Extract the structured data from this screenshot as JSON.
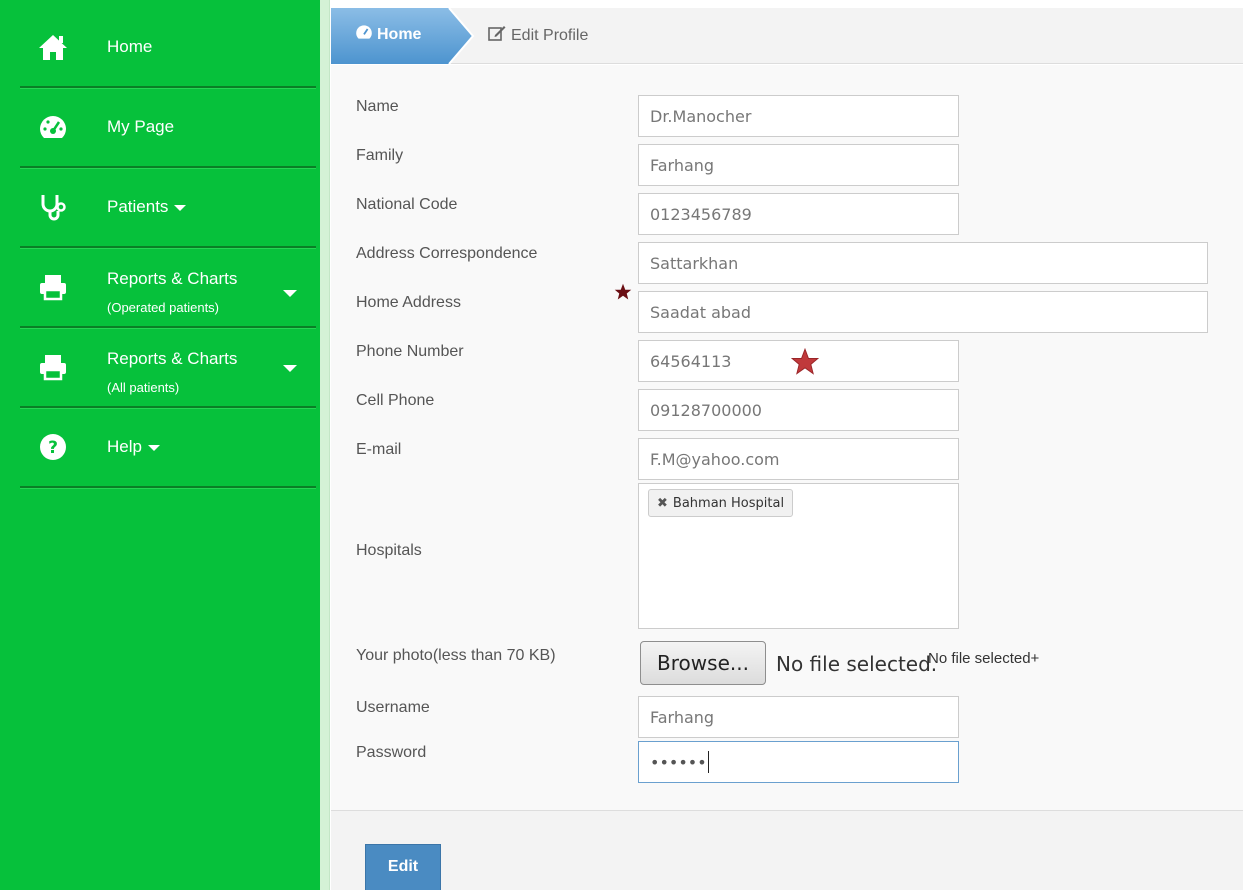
{
  "sidebar": {
    "items": [
      {
        "label": "Home",
        "icon": "home-icon"
      },
      {
        "label": "My Page",
        "icon": "dashboard-icon"
      },
      {
        "label": "Patients",
        "icon": "stethoscope-icon"
      },
      {
        "label": "Reports & Charts",
        "sublabel": "(Operated patients)",
        "icon": "printer-icon"
      },
      {
        "label": "Reports & Charts",
        "sublabel": "(All patients)",
        "icon": "printer-icon"
      },
      {
        "label": "Help",
        "icon": "question-icon"
      }
    ]
  },
  "breadcrumb": {
    "home": "Home",
    "current": "Edit Profile"
  },
  "form": {
    "name": {
      "label": "Name",
      "value": "Dr.Manocher"
    },
    "family": {
      "label": "Family",
      "value": "Farhang"
    },
    "national_code": {
      "label": "National Code",
      "value": "0123456789"
    },
    "address_correspondence": {
      "label": "Address Correspondence",
      "value": "Sattarkhan"
    },
    "home_address": {
      "label": "Home Address",
      "value": "Saadat abad"
    },
    "phone_number": {
      "label": "Phone Number",
      "value": "64564113"
    },
    "cell_phone": {
      "label": "Cell Phone",
      "value": "09128700000"
    },
    "email": {
      "label": "E-mail",
      "value": "F.M@yahoo.com"
    },
    "hospitals": {
      "label": "Hospitals",
      "tags": [
        "Bahman Hospital"
      ]
    },
    "photo": {
      "label": "Your photo(less than 70 KB)",
      "browse_label": "Browse...",
      "file_status": "No file selected.",
      "file_status_extra": "No file selected+"
    },
    "username": {
      "label": "Username",
      "value": "Farhang"
    },
    "password": {
      "label": "Password",
      "value": "••••••"
    },
    "submit_label": "Edit"
  },
  "colors": {
    "sidebar": "#06c13b",
    "accent": "#4a8bc2",
    "star": "#c0393b",
    "star_dark": "#6b0f14"
  }
}
